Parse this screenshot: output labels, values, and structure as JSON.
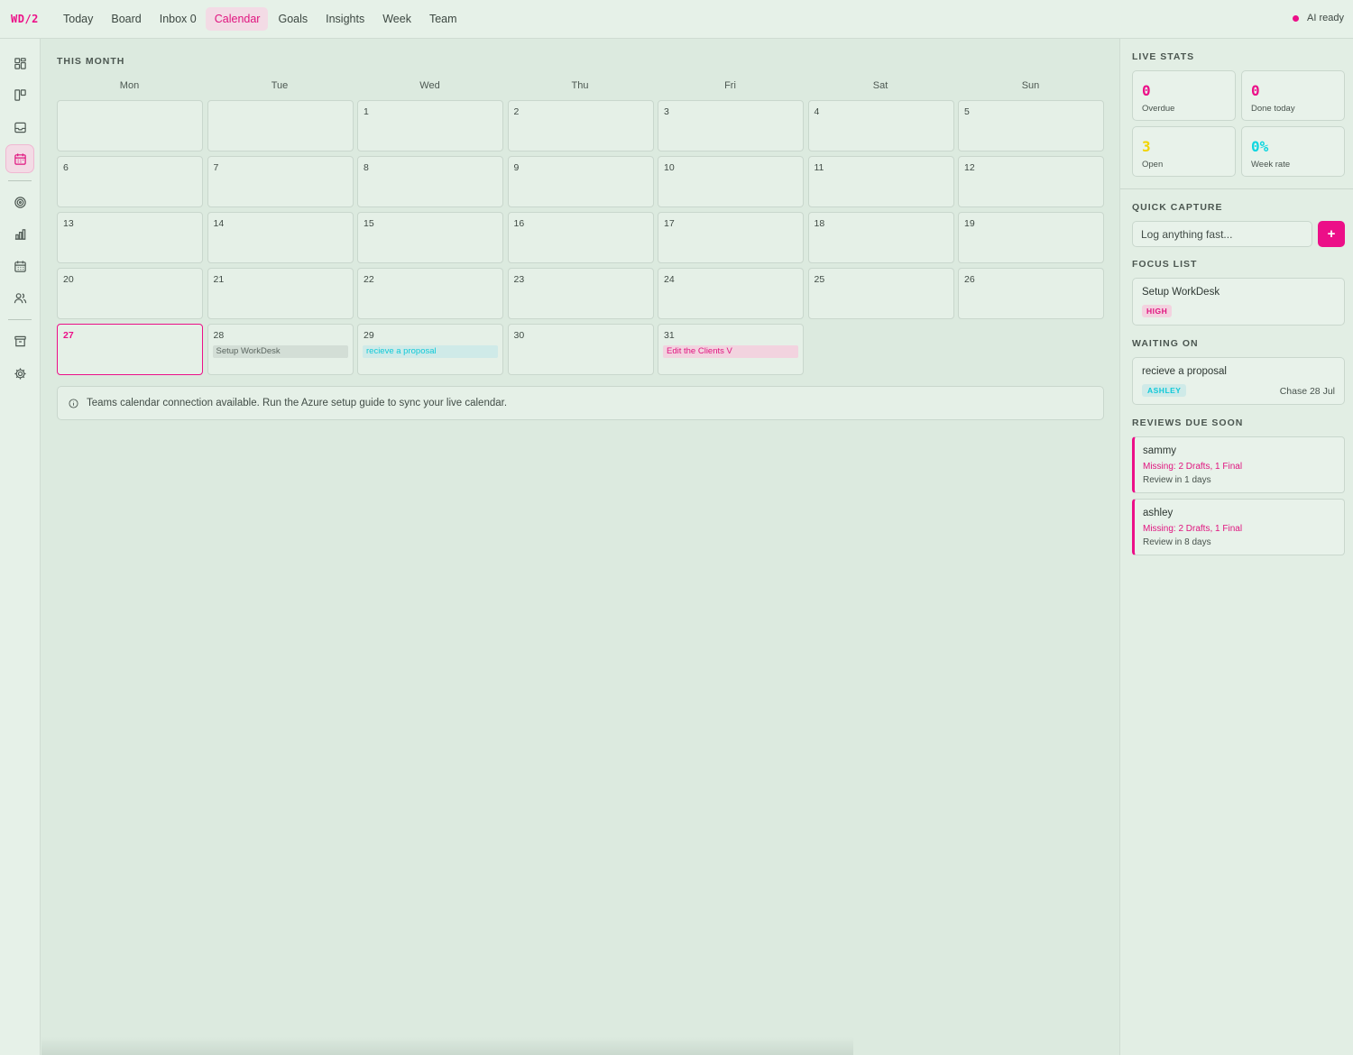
{
  "app": {
    "logo": "WD/2"
  },
  "nav": {
    "items": [
      {
        "label": "Today",
        "active": false
      },
      {
        "label": "Board",
        "active": false
      },
      {
        "label": "Inbox 0",
        "active": false
      },
      {
        "label": "Calendar",
        "active": true
      },
      {
        "label": "Goals",
        "active": false
      },
      {
        "label": "Insights",
        "active": false
      },
      {
        "label": "Week",
        "active": false
      },
      {
        "label": "Team",
        "active": false
      }
    ],
    "ai_status": "AI ready"
  },
  "rail": {
    "icons": [
      "dashboard-icon",
      "board-icon",
      "inbox-icon",
      "calendar-icon",
      "goals-icon",
      "insights-icon",
      "week-icon",
      "team-icon",
      "archive-icon",
      "settings-icon"
    ],
    "active": "calendar-icon"
  },
  "calendar": {
    "title": "THIS MONTH",
    "weekdays": [
      "Mon",
      "Tue",
      "Wed",
      "Thu",
      "Fri",
      "Sat",
      "Sun"
    ],
    "weeks": [
      [
        "",
        "",
        "1",
        "2",
        "3",
        "4",
        "5"
      ],
      [
        "6",
        "7",
        "8",
        "9",
        "10",
        "11",
        "12"
      ],
      [
        "13",
        "14",
        "15",
        "16",
        "17",
        "18",
        "19"
      ],
      [
        "20",
        "21",
        "22",
        "23",
        "24",
        "25",
        "26"
      ],
      [
        "27",
        "28",
        "29",
        "30",
        "31",
        "",
        ""
      ]
    ],
    "today": "27",
    "events": {
      "28": {
        "label": "Setup WorkDesk",
        "style": "grey"
      },
      "29": {
        "label": "recieve a proposal",
        "style": "cyan"
      },
      "31": {
        "label": "Edit the Clients V",
        "style": "pink"
      }
    },
    "banner": "Teams calendar connection available. Run the Azure setup guide to sync your live calendar."
  },
  "panel": {
    "live_stats": {
      "title": "LIVE STATS",
      "overdue": {
        "value": "0",
        "label": "Overdue",
        "color": "#ec0f88"
      },
      "done_today": {
        "value": "0",
        "label": "Done today",
        "color": "#ec0f88"
      },
      "open": {
        "value": "3",
        "label": "Open",
        "color": "#f2d400"
      },
      "week_rate": {
        "value": "0%",
        "label": "Week rate",
        "color": "#10d6e0"
      }
    },
    "quick_capture": {
      "title": "QUICK CAPTURE",
      "placeholder": "Log anything fast...",
      "button": "+"
    },
    "focus_list": {
      "title": "FOCUS LIST",
      "item": "Setup WorkDesk",
      "tag": "HIGH"
    },
    "waiting_on": {
      "title": "WAITING ON",
      "item": "recieve a proposal",
      "tag": "ASHLEY",
      "chase": "Chase 28 Jul"
    },
    "reviews": {
      "title": "REVIEWS DUE SOON",
      "items": [
        {
          "name": "sammy",
          "missing": "Missing: 2 Drafts, 1 Final",
          "due": "Review in 1 days"
        },
        {
          "name": "ashley",
          "missing": "Missing: 2 Drafts, 1 Final",
          "due": "Review in 8 days"
        }
      ]
    }
  }
}
